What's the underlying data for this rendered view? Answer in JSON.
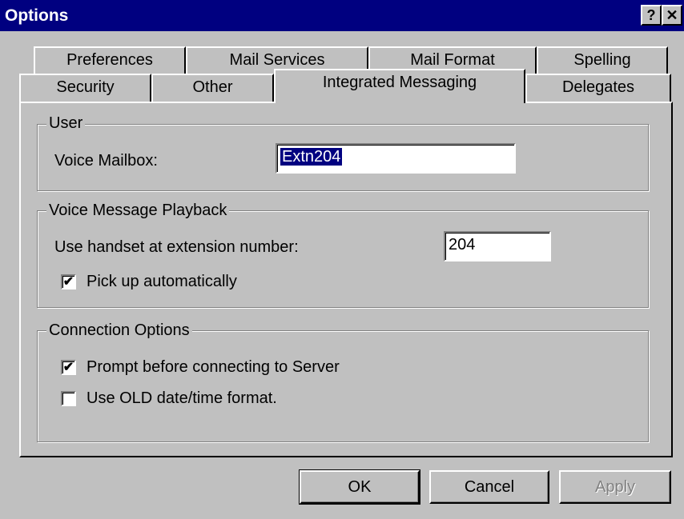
{
  "window": {
    "title": "Options",
    "help_glyph": "?",
    "close_glyph": "✕"
  },
  "tabs": {
    "row1": [
      {
        "label": "Preferences"
      },
      {
        "label": "Mail Services"
      },
      {
        "label": "Mail Format"
      },
      {
        "label": "Spelling"
      }
    ],
    "row2": [
      {
        "label": "Security"
      },
      {
        "label": "Other"
      },
      {
        "label": "Integrated Messaging",
        "active": true
      },
      {
        "label": "Delegates"
      }
    ]
  },
  "user_group": {
    "legend": "User",
    "voice_mailbox_label": "Voice Mailbox:",
    "voice_mailbox_value": "Extn204"
  },
  "playback_group": {
    "legend": "Voice Message Playback",
    "extension_label": "Use handset at extension number:",
    "extension_value": "204",
    "pickup_label": "Pick up automatically",
    "pickup_checked": true
  },
  "connection_group": {
    "legend": "Connection Options",
    "prompt_label": "Prompt before connecting to Server",
    "prompt_checked": true,
    "old_date_label": "Use OLD date/time format.",
    "old_date_checked": false
  },
  "buttons": {
    "ok": "OK",
    "cancel": "Cancel",
    "apply": "Apply"
  },
  "check_glyph": "✔"
}
